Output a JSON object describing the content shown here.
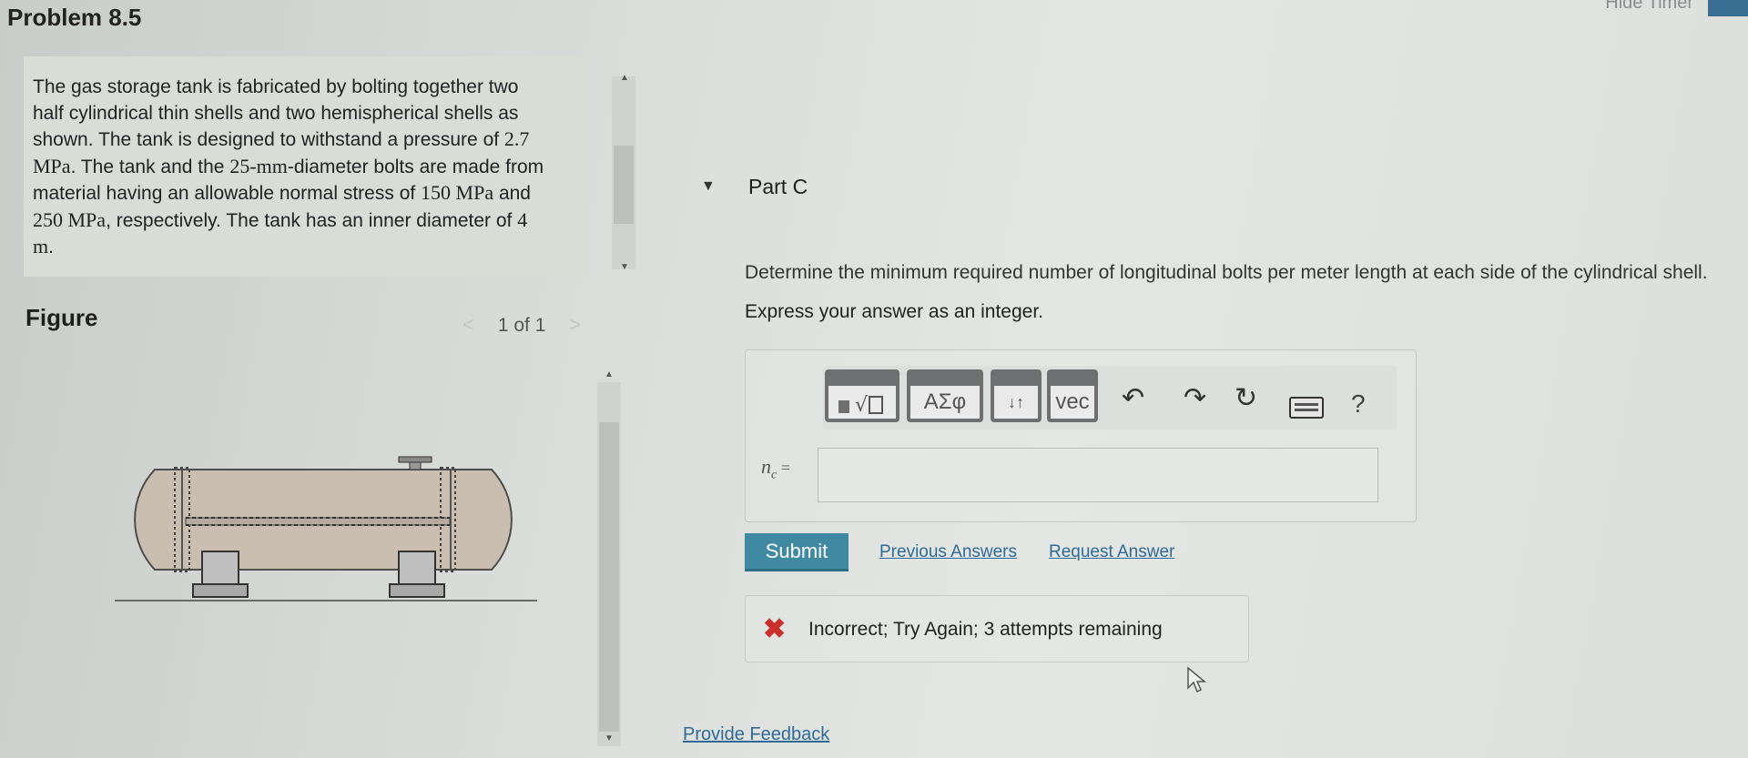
{
  "header": {
    "problem_title": "Problem 8.5",
    "hide_timer_label": "Hide Timer"
  },
  "problem": {
    "text_parts": [
      "The gas storage tank is fabricated by bolting together two half cylindrical thin shells and two hemispherical shells as shown. The tank is designed to withstand a pressure of ",
      "2.7 MPa",
      ". The tank and the ",
      "25-mm",
      "-diameter bolts are made from material having an allowable normal stress of ",
      "150 MPa",
      " and ",
      "250 MPa",
      ", respectively. The tank has an inner diameter of ",
      "4 m",
      "."
    ]
  },
  "figure": {
    "label": "Figure",
    "pager_text": "1 of 1",
    "prev_glyph": "<",
    "next_glyph": ">"
  },
  "part": {
    "toggle_glyph": "▼",
    "title": "Part C",
    "question": "Determine the minimum required number of longitudinal bolts per meter length at each side of the cylindrical shell.",
    "instruction": "Express your answer as an integer."
  },
  "toolbar": {
    "templates_icon": "templates-icon",
    "greek_label": "ΑΣφ",
    "arrows_label": "↓↑",
    "vec_label": "vec",
    "help_label": "?"
  },
  "answer": {
    "variable_label": "n",
    "variable_sub": "c",
    "equals": " =",
    "value": ""
  },
  "actions": {
    "submit_label": "Submit",
    "previous_answers_label": "Previous Answers",
    "request_answer_label": "Request Answer"
  },
  "feedback": {
    "icon": "✖",
    "message": "Incorrect; Try Again; 3 attempts remaining"
  },
  "footer": {
    "provide_feedback_label": "Provide Feedback"
  },
  "colors": {
    "submit": "#3f8aa2",
    "link": "#2f6a98",
    "error": "#c9302c"
  }
}
